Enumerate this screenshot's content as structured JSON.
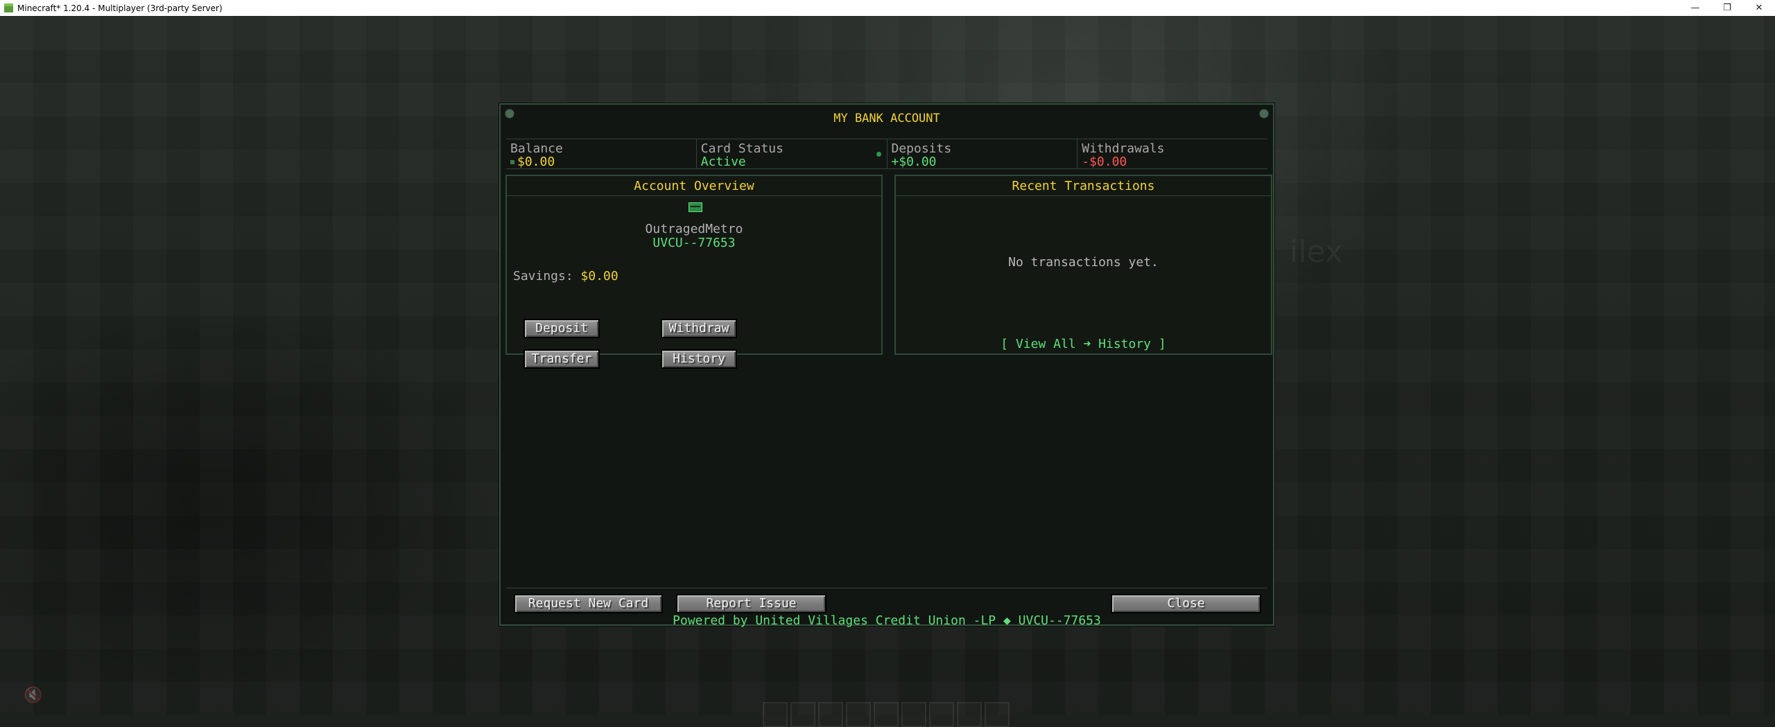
{
  "window": {
    "title": "Minecraft* 1.20.4 - Multiplayer (3rd-party Server)",
    "controls": [
      "—",
      "❐",
      "✕"
    ]
  },
  "background": {
    "ghost_text": "ilex"
  },
  "panel": {
    "title": "MY BANK ACCOUNT",
    "stats": [
      {
        "label": "Balance",
        "value": "$0.00"
      },
      {
        "label": "Card Status",
        "value": "Active"
      },
      {
        "label": "Deposits",
        "value": "+$0.00"
      },
      {
        "label": "Withdrawals",
        "value": "-$0.00"
      }
    ],
    "overview": {
      "title": "Account Overview",
      "username": "OutragedMetro",
      "account_id": "UVCU--77653",
      "savings_label": "Savings:",
      "savings_value": "$0.00",
      "buttons": {
        "deposit": "Deposit",
        "withdraw": "Withdraw",
        "transfer": "Transfer",
        "history": "History"
      }
    },
    "recent": {
      "title": "Recent Transactions",
      "empty_text": "No transactions yet.",
      "view_all": "[ View All ➜ History ]"
    },
    "footer": {
      "request_card": "Request New Card",
      "report_issue": "Report Issue",
      "close": "Close",
      "powered_by": "Powered by United Villages Credit Union -LP  ◆  UVCU--77653"
    }
  },
  "colors": {
    "gold": "#f2d23a",
    "green": "#5fe07a",
    "red": "#ff5555",
    "border": "#34503d"
  }
}
